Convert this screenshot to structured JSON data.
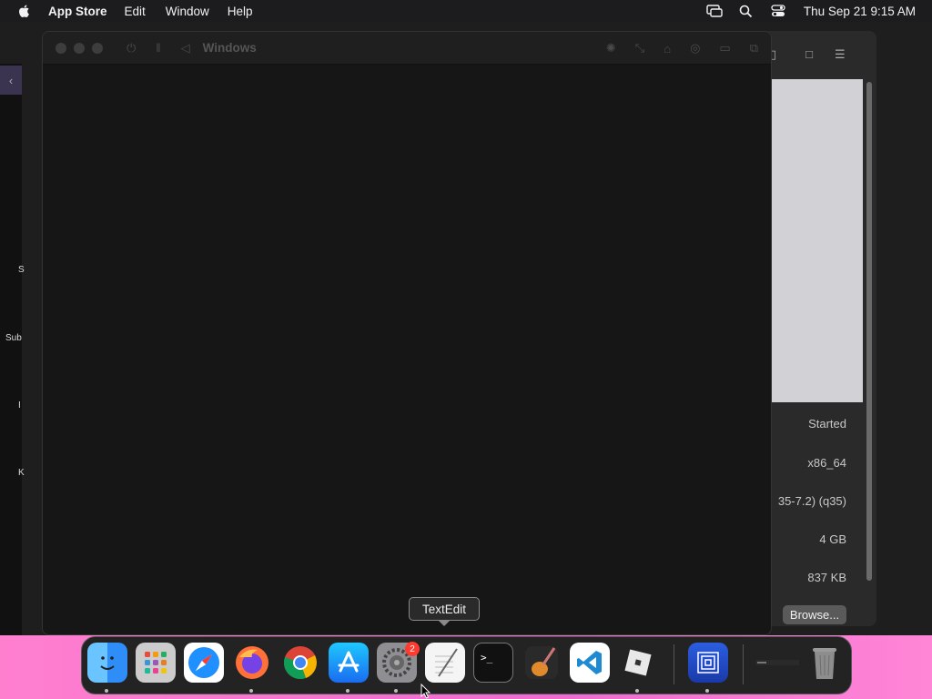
{
  "menubar": {
    "app_name": "App Store",
    "items": [
      "Edit",
      "Window",
      "Help"
    ],
    "clock": "Thu Sep 21  9:15 AM",
    "status_icons": [
      "screen-mirroring-icon",
      "spotlight-search-icon",
      "control-center-icon"
    ]
  },
  "sidebar_fragments": {
    "f1": "S",
    "f2": "Sub",
    "f3": "I",
    "f4": "K"
  },
  "vm_window": {
    "title": "Windows",
    "toolbar_left": [
      "power-icon",
      "pause-icon",
      "back-triangle-icon"
    ],
    "toolbar_right": [
      "brightness-icon",
      "resize-icon",
      "usb-icon",
      "share-icon",
      "folder-icon",
      "windows-icon"
    ]
  },
  "settings_panel": {
    "rows": [
      {
        "value": "Started"
      },
      {
        "value": "x86_64"
      },
      {
        "value": "35-7.2) (q35)"
      },
      {
        "value": "4 GB"
      },
      {
        "value": "837 KB"
      }
    ],
    "browse_label": "Browse..."
  },
  "tooltip": {
    "text": "TextEdit"
  },
  "dock": {
    "items": [
      {
        "name": "Finder",
        "icon": "finder-icon",
        "running": true
      },
      {
        "name": "Launchpad",
        "icon": "launchpad-icon",
        "running": false
      },
      {
        "name": "Safari",
        "icon": "safari-icon",
        "running": false
      },
      {
        "name": "Firefox",
        "icon": "firefox-icon",
        "running": true
      },
      {
        "name": "Chrome",
        "icon": "chrome-icon",
        "running": false
      },
      {
        "name": "App Store",
        "icon": "app-store-icon",
        "running": true
      },
      {
        "name": "System Settings",
        "icon": "system-settings-icon",
        "running": true,
        "badge": "2"
      },
      {
        "name": "TextEdit",
        "icon": "textedit-icon",
        "running": false
      },
      {
        "name": "Terminal",
        "icon": "terminal-icon",
        "running": false
      },
      {
        "name": "GarageBand",
        "icon": "garageband-icon",
        "running": false
      },
      {
        "name": "Visual Studio Code",
        "icon": "vscode-icon",
        "running": false
      },
      {
        "name": "Roblox",
        "icon": "roblox-icon",
        "running": true
      },
      {
        "name": "UTM",
        "icon": "utm-icon",
        "running": true
      },
      {
        "name": "Minimized Window",
        "icon": "minimized-window-icon",
        "running": false
      },
      {
        "name": "Trash",
        "icon": "trash-icon",
        "running": false
      }
    ]
  }
}
